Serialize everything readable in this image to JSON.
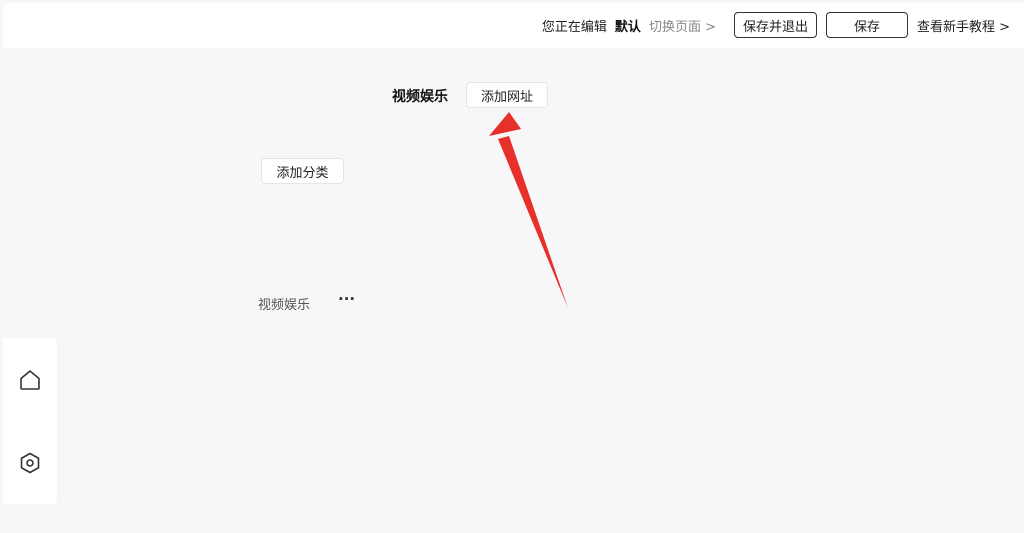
{
  "topbar": {
    "editing_prefix": "您正在编辑",
    "editing_page": "默认",
    "switch_page": "切换页面 >",
    "save_exit_label": "保存并退出",
    "save_label": "保存",
    "tutorial_label": "查看新手教程 >"
  },
  "main": {
    "group_title": "视频娱乐",
    "add_url_label": "添加网址",
    "add_category_label": "添加分类",
    "categories": [
      {
        "label": "视频娱乐",
        "more": "···"
      }
    ]
  },
  "sidebar": {
    "icons": [
      "home-icon",
      "settings-icon"
    ]
  },
  "colors": {
    "background": "#f7f7fa",
    "annotation_arrow": "#e8302a"
  }
}
